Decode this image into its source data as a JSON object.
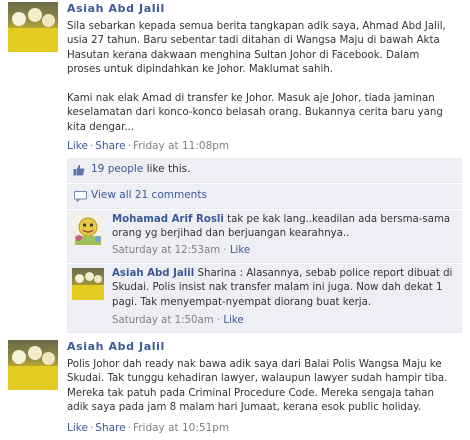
{
  "posts": [
    {
      "author": "Asiah Abd Jalil",
      "message": "Sila sebarkan kepada semua berita tangkapan adik saya, Ahmad Abd Jalil,\nusia 27 tahun. Baru sebentar tadi ditahan di Wangsa Maju di bawah Akta\nHasutan kerana dakwaan menghina Sultan Johor di Facebook. Dalam\nproses untuk dipindahkan ke Johor. Maklumat sahih.\n\nKami nak elak Amad di transfer ke Johor. Masuk aje Johor, tiada jaminan\nkeselamatan dari konco-konco belasah orang. Bukannya cerita baru yang\nkita dengar...",
      "like_label": "Like",
      "share_label": "Share",
      "timestamp": "Friday at 11:08pm"
    },
    {
      "author": "Asiah Abd Jalil",
      "message": "Polis Johor dah ready nak bawa adik saya dari Balai Polis Wangsa Maju ke\nSkudai. Tak tunggu kehadiran lawyer, walaupun lawyer sudah hampir tiba.\nMereka tak patuh pada Criminal Procedure Code. Mereka sengaja tahan\nadik saya pada jam 8 malam hari Jumaat, kerana esok public holiday.",
      "like_label": "Like",
      "share_label": "Share",
      "timestamp": "Friday at 10:51pm"
    }
  ],
  "likes": {
    "count_link": "19 people",
    "suffix": " like this."
  },
  "view_all": "View all 21 comments",
  "comments": [
    {
      "name": "Mohamad Arif Rosli",
      "text": " tak pe kak lang..keadilan ada bersma-sama orang yg berjihad dan berjuangan kearahnya..",
      "timestamp": "Saturday at 12:53am",
      "like_label": "Like"
    },
    {
      "name": "Asiah Abd Jalil",
      "text": " Sharina : Alasannya, sebab police report dibuat di Skudai. Polis insist nak transfer malam ini juga. Now dah dekat 1 pagi. Tak menyempat-nyempat diorang buat kerja.",
      "timestamp": "Saturday at 1:50am",
      "like_label": "Like"
    }
  ],
  "colors": {
    "link": "#3b5998",
    "ufi_bg": "#edeff4",
    "meta": "#808080"
  }
}
